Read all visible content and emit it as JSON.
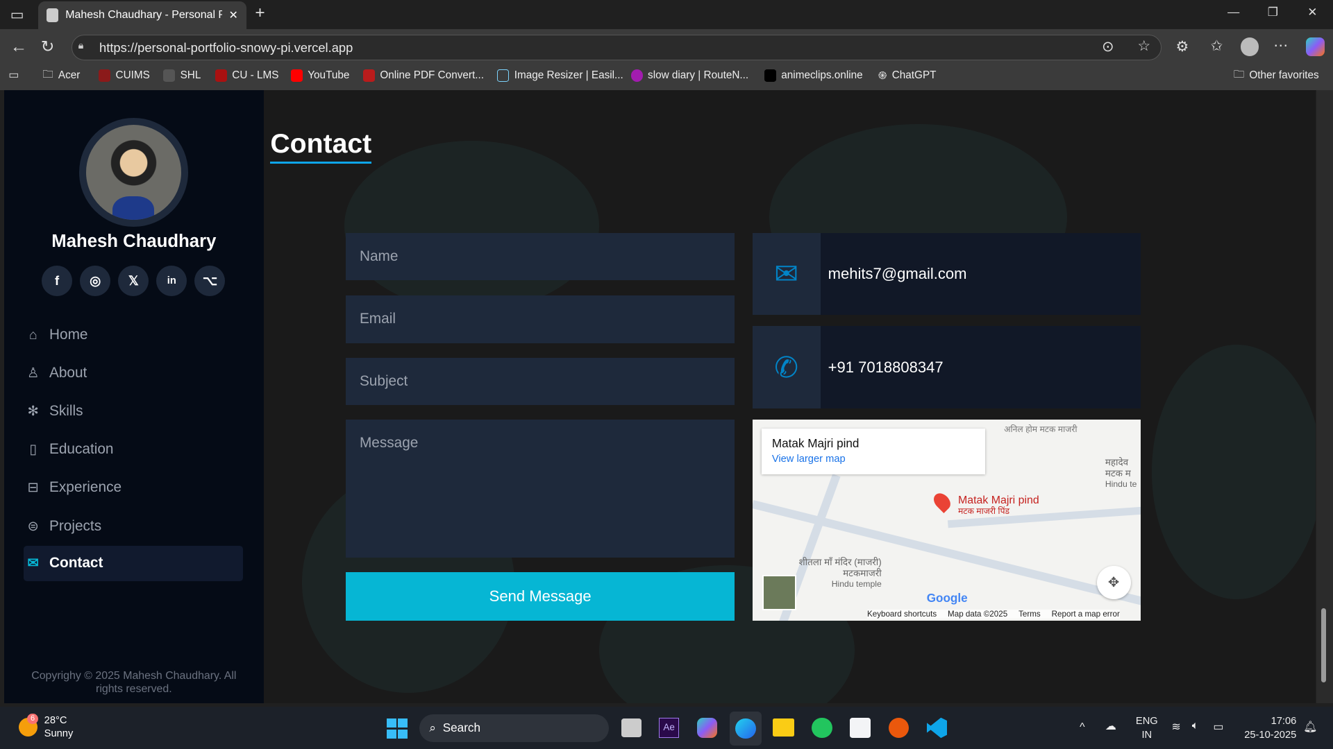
{
  "browser": {
    "tab_title": "Mahesh Chaudhary - Personal Por",
    "url": "https://personal-portfolio-snowy-pi.vercel.app",
    "bookmarks": [
      "Acer",
      "CUIMS",
      "SHL",
      "CU - LMS",
      "YouTube",
      "Online PDF Convert...",
      "Image Resizer | Easil...",
      "slow diary | RouteN...",
      "animeclips.online",
      "ChatGPT"
    ],
    "other_favorites": "Other favorites"
  },
  "sidebar": {
    "name": "Mahesh Chaudhary",
    "social": [
      "facebook",
      "instagram",
      "x",
      "linkedin",
      "github"
    ],
    "nav": [
      {
        "label": "Home"
      },
      {
        "label": "About"
      },
      {
        "label": "Skills"
      },
      {
        "label": "Education"
      },
      {
        "label": "Experience"
      },
      {
        "label": "Projects"
      },
      {
        "label": "Contact",
        "active": true
      }
    ],
    "copyright": "Copyrighy © 2025 Mahesh Chaudhary. All rights reserved."
  },
  "main": {
    "title": "Contact",
    "form": {
      "name_placeholder": "Name",
      "email_placeholder": "Email",
      "subject_placeholder": "Subject",
      "message_placeholder": "Message",
      "submit": "Send Message"
    },
    "email": "mehits7@gmail.com",
    "phone": "+91 7018808347",
    "map": {
      "place": "Matak Majri pind",
      "larger": "View larger map",
      "pin_label": "Matak Majri pind",
      "pin_label_hi": "मटक माजरी पिंड",
      "poi1": "अनिल होम मटक माजरी",
      "poi2": "महादेव मटक म",
      "poi2_sub": "Hindu te",
      "poi3": "शीतला माँ मंदिर (माजरी) मटकमाजरी",
      "poi3_sub": "Hindu temple",
      "google": "Google",
      "footer": [
        "Keyboard shortcuts",
        "Map data ©2025",
        "Terms",
        "Report a map error"
      ]
    }
  },
  "taskbar": {
    "weather_temp": "28°C",
    "weather_desc": "Sunny",
    "badge": "6",
    "search": "Search",
    "lang": "ENG",
    "region": "IN",
    "time": "17:06",
    "date": "25-10-2025"
  },
  "colors": {
    "accent": "#06b6d4",
    "sidebar": "#050b16",
    "card": "#1e293b"
  }
}
